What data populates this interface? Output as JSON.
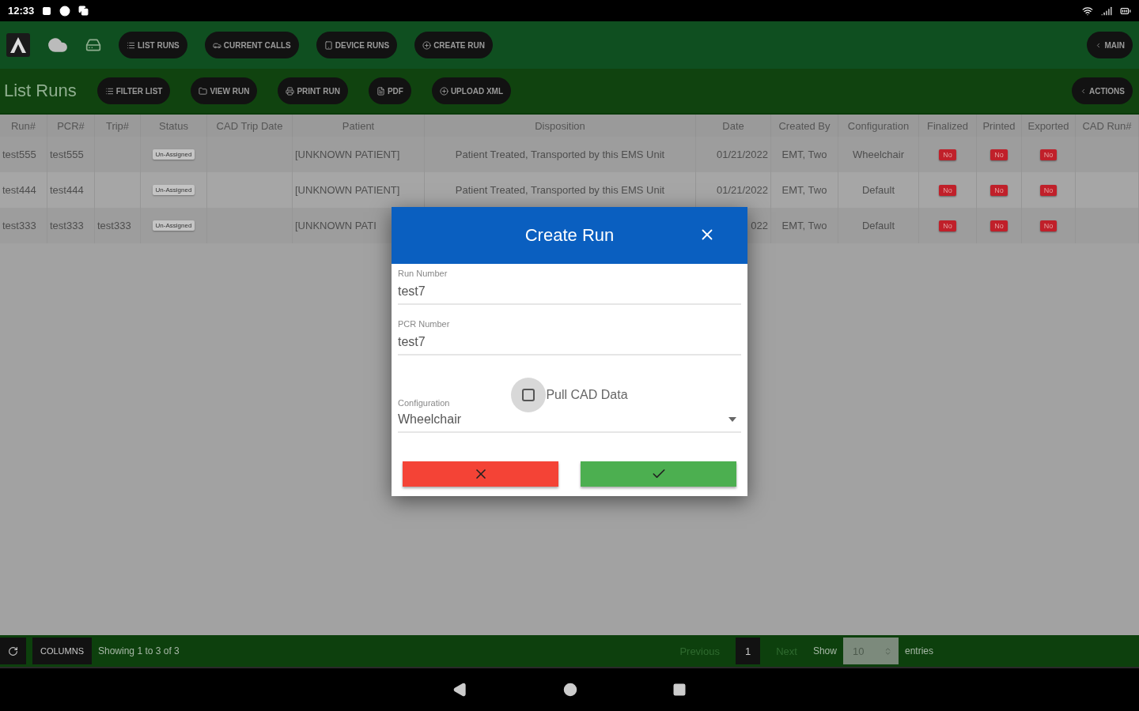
{
  "status_bar": {
    "time": "12:33"
  },
  "top_nav": {
    "buttons": [
      {
        "label": "LIST RUNS",
        "kind": "list"
      },
      {
        "label": "CURRENT CALLS",
        "kind": "car"
      },
      {
        "label": "DEVICE RUNS",
        "kind": "tablet"
      },
      {
        "label": "CREATE RUN",
        "kind": "plus"
      }
    ],
    "main_button": "MAIN"
  },
  "toolbar": {
    "title": "List Runs",
    "buttons": [
      {
        "label": "FILTER LIST",
        "kind": "list"
      },
      {
        "label": "VIEW RUN",
        "kind": "folder"
      },
      {
        "label": "PRINT RUN",
        "kind": "printer"
      },
      {
        "label": "PDF",
        "kind": "file"
      },
      {
        "label": "UPLOAD XML",
        "kind": "plus"
      }
    ],
    "actions_button": "ACTIONS"
  },
  "table": {
    "columns": [
      "Run#",
      "PCR#",
      "Trip#",
      "Status",
      "CAD Trip Date",
      "Patient",
      "Disposition",
      "Date",
      "Created By",
      "Configuration",
      "Finalized",
      "Printed",
      "Exported",
      "CAD Run#"
    ],
    "rows": [
      {
        "run_number": "test555",
        "pcr_number": "test555",
        "status": "Un-Assigned",
        "patient": "[UNKNOWN PATIENT]",
        "disposition": "Patient Treated, Transported by this EMS Unit",
        "date": "01/21/2022",
        "created_by": "EMT, Two",
        "configuration": "Wheelchair",
        "finalized": "No",
        "printed": "No",
        "exported": "No"
      },
      {
        "run_number": "test444",
        "pcr_number": "test444",
        "status": "Un-Assigned",
        "patient": "[UNKNOWN PATIENT]",
        "disposition": "Patient Treated, Transported by this EMS Unit",
        "date": "01/21/2022",
        "created_by": "EMT, Two",
        "configuration": "Default",
        "finalized": "No",
        "printed": "No",
        "exported": "No"
      },
      {
        "run_number": "test333",
        "pcr_number": "test333",
        "trip_number": "test333",
        "status": "Un-Assigned",
        "patient": "[UNKNOWN PATI",
        "date": "022",
        "created_by": "EMT, Two",
        "configuration": "Default",
        "finalized": "No",
        "printed": "No",
        "exported": "No"
      }
    ]
  },
  "dialog": {
    "title": "Create Run",
    "fields": [
      {
        "label": "Run Number",
        "value": "test7"
      },
      {
        "label": "PCR Number",
        "value": "test7"
      }
    ],
    "checkbox": {
      "label": "Pull CAD Data",
      "checked": false
    },
    "select": {
      "label": "Configuration",
      "value": "Wheelchair"
    }
  },
  "footer": {
    "columns_button": "COLUMNS",
    "info": "Showing 1 to 3 of 3",
    "previous": {
      "label": "Previous",
      "disabled": true
    },
    "pages": [
      {
        "label": "1",
        "selected": true
      }
    ],
    "next": {
      "label": "Next",
      "disabled": true
    },
    "show_label": "Show",
    "page_size": "10",
    "entries_label": "entries"
  }
}
